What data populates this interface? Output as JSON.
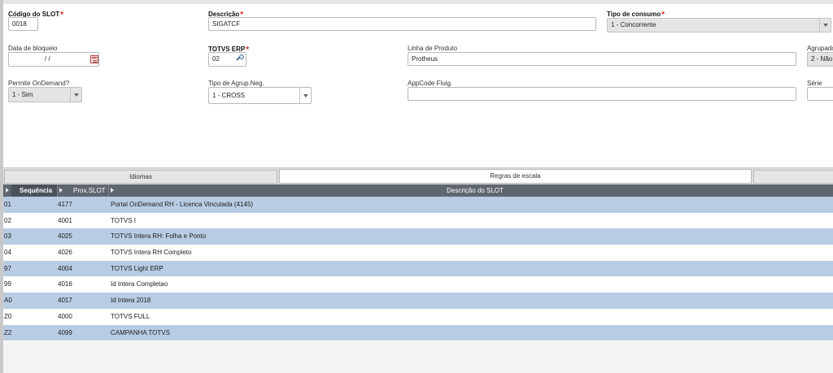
{
  "form": {
    "codigo_slot": {
      "label": "Código do SLOT",
      "value": "0018"
    },
    "descricao": {
      "label": "Descrição",
      "value": "SIGATCF"
    },
    "tipo_consumo": {
      "label": "Tipo de consumo",
      "value": "1 - Concorrente"
    },
    "data_bloqueio": {
      "label": "Data de bloqueio",
      "value": "/ /"
    },
    "totvs_erp": {
      "label": "TOTVS ERP",
      "value": "02"
    },
    "linha_produto": {
      "label": "Linha de Produto",
      "value": "Protheus"
    },
    "agrupado": {
      "label": "Agrupado",
      "value": "2 - Não"
    },
    "permite_ondemand": {
      "label": "Permite OnDemand?",
      "value": "1 - Sim"
    },
    "tipo_agrup_neg": {
      "label": "Tipo de Agrup.Neg.",
      "value": "1 - CROSS"
    },
    "appcode_fluig": {
      "label": "AppCode Fluig.",
      "value": ""
    },
    "serie": {
      "label": "Série",
      "value": ""
    },
    "required_mark": "*"
  },
  "tabs": [
    {
      "label": "Idiomas",
      "active": false
    },
    {
      "label": "Regras de escala",
      "active": true
    },
    {
      "label": "",
      "active": false
    }
  ],
  "grid": {
    "columns": [
      "Sequência",
      "Prox.SLOT",
      "Descrição do SLOT"
    ],
    "rows": [
      {
        "seq": "01",
        "prox": "4177",
        "desc": "Portal OnDemand RH - Licenca Vinculada (4145)"
      },
      {
        "seq": "02",
        "prox": "4001",
        "desc": "TOTVS I"
      },
      {
        "seq": "03",
        "prox": "4025",
        "desc": "TOTVS Intera RH: Folha e Ponto"
      },
      {
        "seq": "04",
        "prox": "4026",
        "desc": "TOTVS Intera RH Completo"
      },
      {
        "seq": "97",
        "prox": "4004",
        "desc": "TOTVS Light ERP"
      },
      {
        "seq": "99",
        "prox": "4016",
        "desc": "Id Intera Completao"
      },
      {
        "seq": "A0",
        "prox": "4017",
        "desc": "Id Intera 2018"
      },
      {
        "seq": "Z0",
        "prox": "4000",
        "desc": "TOTVS FULL"
      },
      {
        "seq": "Z2",
        "prox": "4099",
        "desc": "CAMPANHA TOTVS"
      }
    ]
  },
  "icons": {
    "calendar": "calendar-icon",
    "lookup": "magnifier-icon",
    "dropdown": "chevron-down-icon",
    "column_marker": "triangle-right-icon"
  },
  "colors": {
    "required": "#dd2222",
    "grid_header": "#5f6670",
    "row_highlight": "#b8cce4"
  }
}
